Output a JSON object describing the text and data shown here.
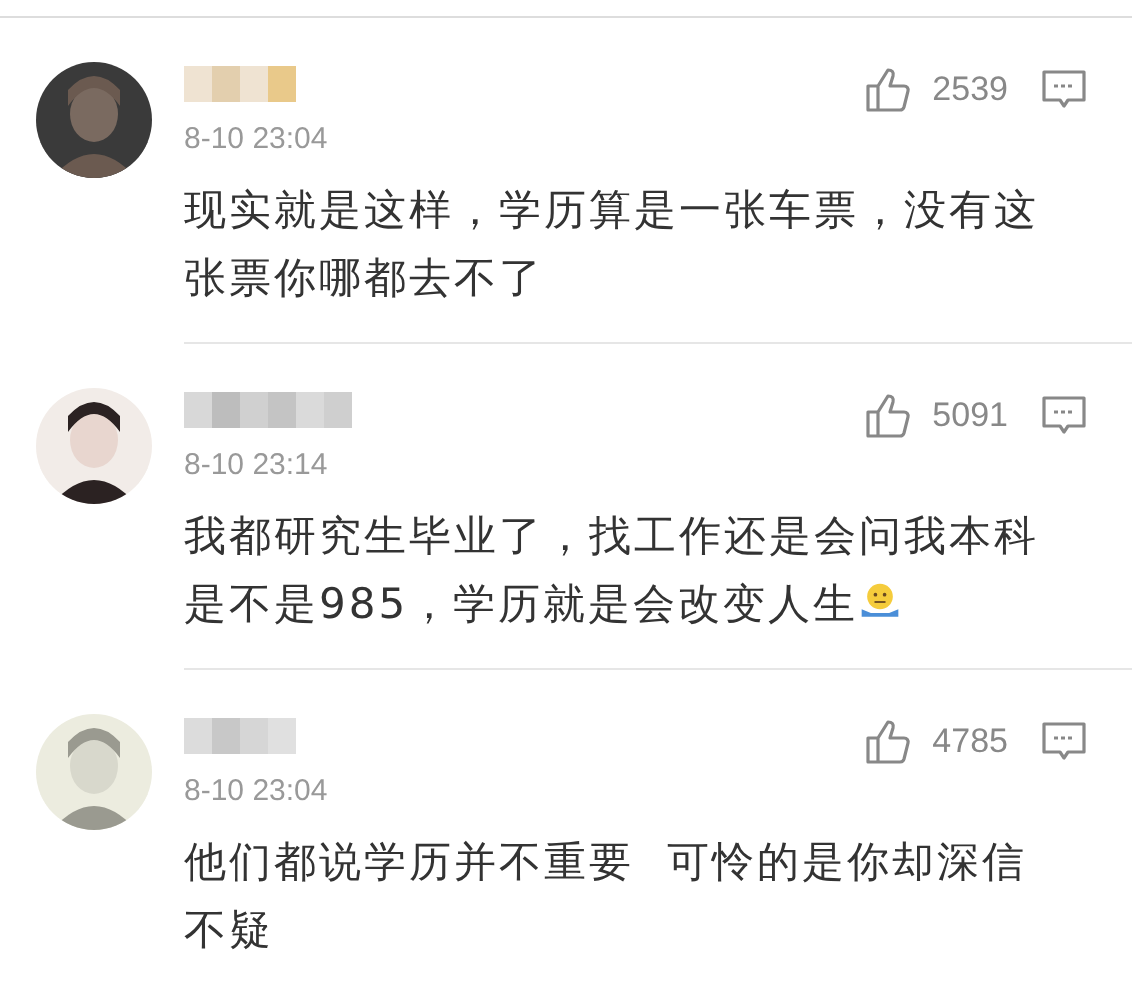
{
  "comments": [
    {
      "time": "8-10 23:04",
      "likes": "2539",
      "text": "现实就是这样，学历算是一张车票，没有这张票你哪都去不了",
      "emoji": false
    },
    {
      "time": "8-10 23:14",
      "likes": "5091",
      "text": "我都研究生毕业了，找工作还是会问我本科是不是985，学历就是会改变人生",
      "emoji": true
    },
    {
      "time": "8-10 23:04",
      "likes": "4785",
      "text": "他们都说学历并不重要  可怜的是你却深信不疑",
      "emoji": false
    }
  ]
}
